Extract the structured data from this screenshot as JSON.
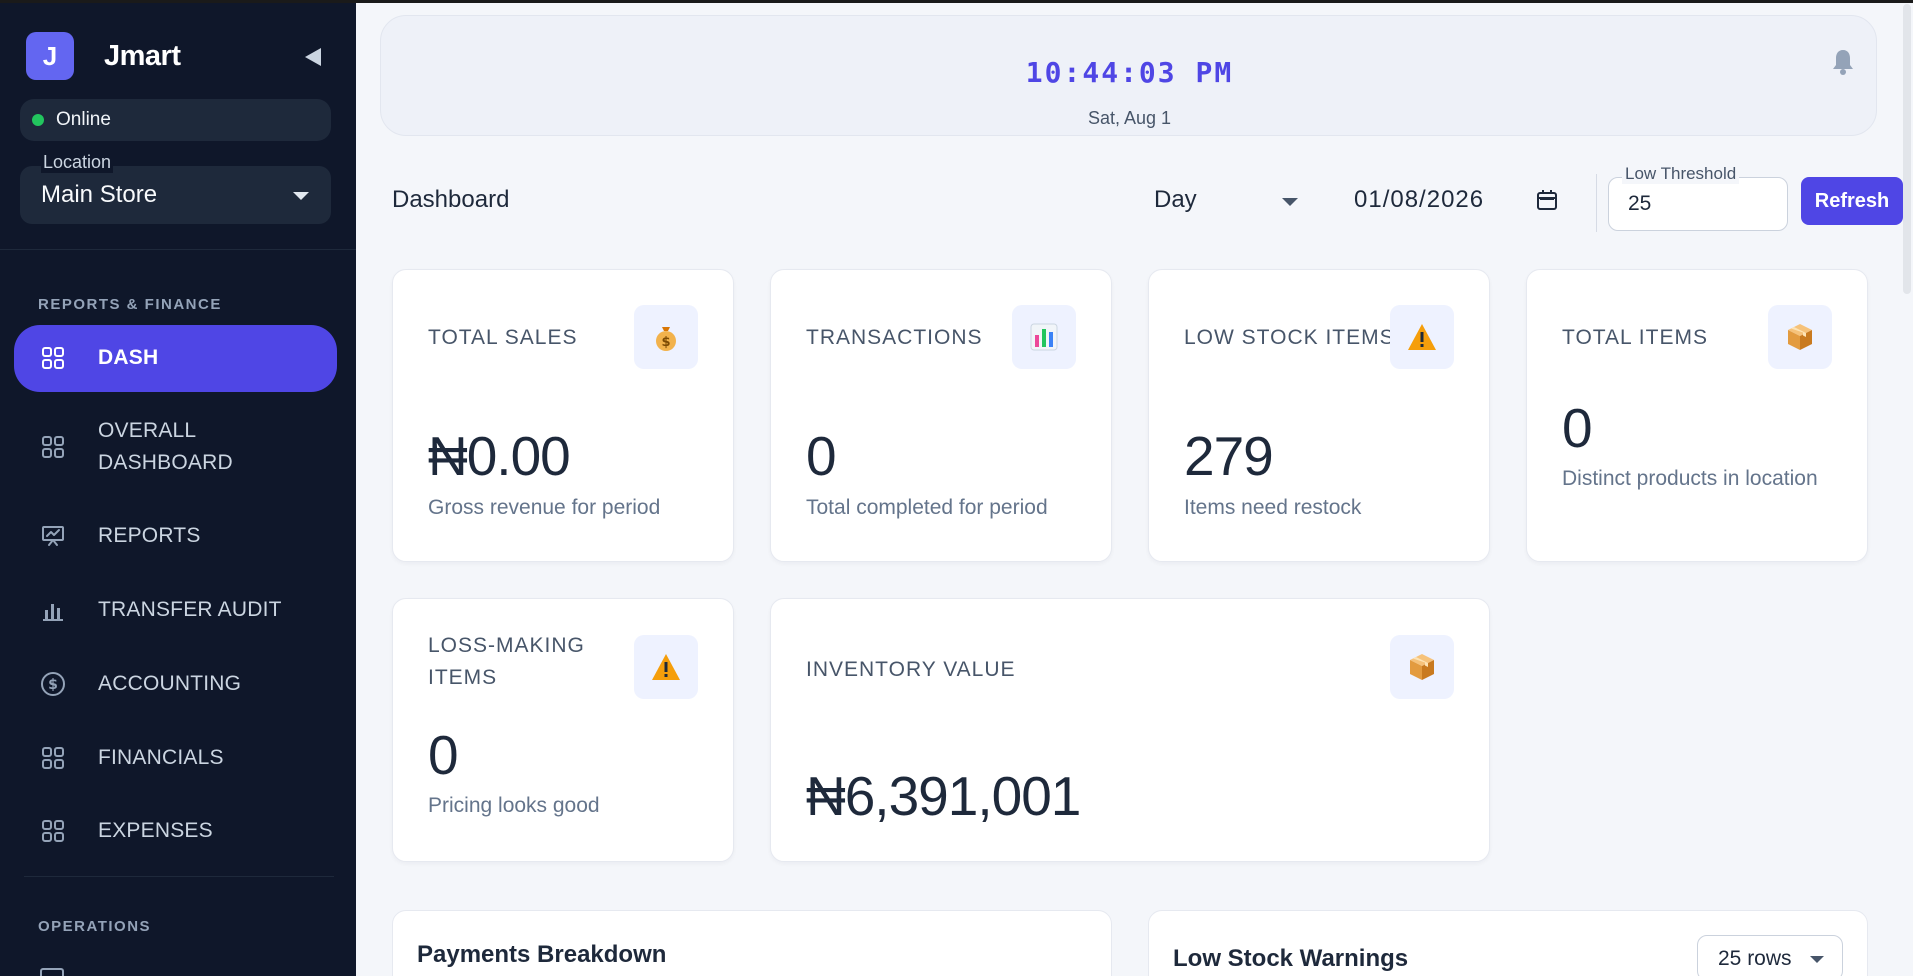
{
  "sidebar": {
    "brand_initial": "J",
    "brand_name": "Jmart",
    "status": "Online",
    "location_label": "Location",
    "location_value": "Main Store",
    "sections": {
      "reports_finance": "REPORTS & FINANCE",
      "operations": "OPERATIONS"
    },
    "items": [
      {
        "label": "DASH",
        "icon": "grid-icon",
        "active": true
      },
      {
        "label": "OVERALL DASHBOARD",
        "icon": "grid-icon",
        "active": false
      },
      {
        "label": "REPORTS",
        "icon": "presentation-chart-icon",
        "active": false
      },
      {
        "label": "TRANSFER AUDIT",
        "icon": "bar-chart-icon",
        "active": false
      },
      {
        "label": "ACCOUNTING",
        "icon": "dollar-circle-icon",
        "active": false
      },
      {
        "label": "FINANCIALS",
        "icon": "grid-icon",
        "active": false
      },
      {
        "label": "EXPENSES",
        "icon": "grid-icon",
        "active": false
      }
    ]
  },
  "clock": {
    "time": "10:44:03 PM",
    "date": "Sat, Aug 1"
  },
  "toolbar": {
    "title": "Dashboard",
    "period": "Day",
    "date": "01/08/2026",
    "threshold_label": "Low Threshold",
    "threshold_value": "25",
    "refresh_label": "Refresh"
  },
  "cards": {
    "total_sales": {
      "title": "TOTAL SALES",
      "value": "₦0.00",
      "sub": "Gross revenue for period",
      "icon": "money-bag-icon"
    },
    "transactions": {
      "title": "TRANSACTIONS",
      "value": "0",
      "sub": "Total completed for period",
      "icon": "bar-chart-icon"
    },
    "low_stock": {
      "title": "LOW STOCK ITEMS",
      "value": "279",
      "sub": "Items need restock",
      "icon": "warning-icon"
    },
    "total_items": {
      "title": "TOTAL ITEMS",
      "value": "0",
      "sub": "Distinct products in location",
      "icon": "package-icon"
    },
    "loss_making": {
      "title": "LOSS-MAKING ITEMS",
      "value": "0",
      "sub": "Pricing looks good",
      "icon": "warning-icon"
    },
    "inventory_value": {
      "title": "INVENTORY VALUE",
      "value": "₦6,391,001",
      "icon": "package-icon"
    }
  },
  "panels": {
    "payments": {
      "title": "Payments Breakdown"
    },
    "low_stock": {
      "title": "Low Stock Warnings",
      "rows_label": "25 rows"
    }
  },
  "colors": {
    "sidebar_bg": "#0f172a",
    "accent": "#4f46e5",
    "online": "#22c55e",
    "page_bg": "#f4f6fa"
  }
}
